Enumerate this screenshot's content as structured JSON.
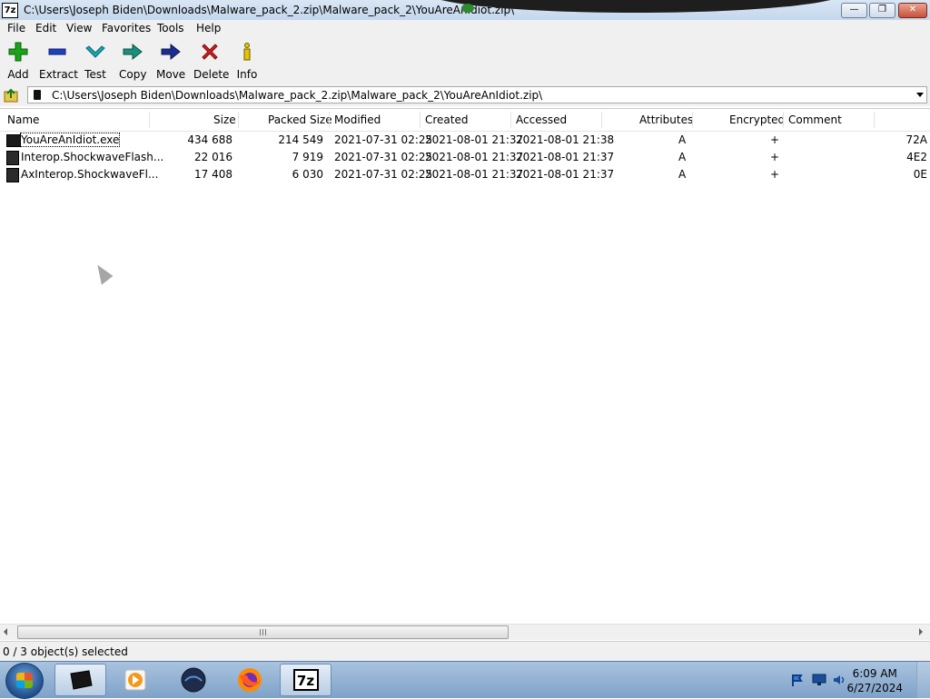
{
  "window": {
    "app_icon": "7z",
    "title": "C:\\Users\\Joseph Biden\\Downloads\\Malware_pack_2.zip\\Malware_pack_2\\YouAreAnIdiot.zip\\",
    "minimize_icon": "minimize-icon",
    "maximize_icon": "maximize-icon",
    "close_icon": "close-icon"
  },
  "menu": [
    "File",
    "Edit",
    "View",
    "Favorites",
    "Tools",
    "Help"
  ],
  "toolbar": {
    "add": "Add",
    "extract": "Extract",
    "test": "Test",
    "copy": "Copy",
    "move": "Move",
    "delete": "Delete",
    "info": "Info"
  },
  "address": {
    "path": "C:\\Users\\Joseph Biden\\Downloads\\Malware_pack_2.zip\\Malware_pack_2\\YouAreAnIdiot.zip\\"
  },
  "columns": [
    "Name",
    "Size",
    "Packed Size",
    "Modified",
    "Created",
    "Accessed",
    "Attributes",
    "Encrypted",
    "Comment"
  ],
  "files": [
    {
      "name": "YouAreAnIdiot.exe",
      "size": "434 688",
      "packed": "214 549",
      "modified": "2021-07-31 02:25",
      "created": "2021-08-01 21:37",
      "accessed": "2021-08-01 21:38",
      "attributes": "A",
      "encrypted": "+",
      "extra": "72A"
    },
    {
      "name": "Interop.ShockwaveFlash...",
      "size": "22 016",
      "packed": "7 919",
      "modified": "2021-07-31 02:25",
      "created": "2021-08-01 21:37",
      "accessed": "2021-08-01 21:37",
      "attributes": "A",
      "encrypted": "+",
      "extra": "4E2"
    },
    {
      "name": "AxInterop.ShockwaveFl...",
      "size": "17 408",
      "packed": "6 030",
      "modified": "2021-07-31 02:25",
      "created": "2021-08-01 21:37",
      "accessed": "2021-08-01 21:37",
      "attributes": "A",
      "encrypted": "+",
      "extra": "0E"
    }
  ],
  "status": "0 / 3 object(s) selected",
  "taskbar": {
    "items": [
      "terminal-icon",
      "media-player-icon",
      "network-globe-icon",
      "firefox-icon",
      "7zip-icon"
    ],
    "active_label": "7z",
    "time": "6:09 AM",
    "date": "6/27/2024"
  },
  "colors": {
    "add_green": "#1aa31a",
    "extract_blue": "#1f3fbf",
    "test_teal": "#19a6b5",
    "move_navy": "#1d2c8f",
    "delete_red": "#d11f1f",
    "info_yellow": "#e8c400"
  }
}
